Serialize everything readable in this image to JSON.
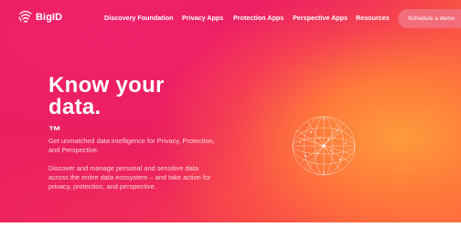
{
  "brand": {
    "name": "BigID"
  },
  "nav": {
    "links": [
      "Discovery Foundation",
      "Privacy Apps",
      "Protection Apps",
      "Perspective Apps",
      "Resources"
    ],
    "cta_label": "Schedule a demo"
  },
  "hero": {
    "headline_line1": "Know your",
    "headline_line2": "data.",
    "headline_mark": "™",
    "intro": "Get unmatched data intelligence for Privacy, Protection, and Perspective.",
    "body": "Discover and manage personal and sensitive data across the entire data ecosystem – and take action for privacy, protection, and perspective."
  },
  "colors": {
    "primary": "#ea1f62",
    "accent_orange": "#fb7a32",
    "cta_background": "#f26c79"
  },
  "icons": {
    "logo": "bigid-fingerprint-icon",
    "graphic": "data-network-sphere-icon"
  }
}
